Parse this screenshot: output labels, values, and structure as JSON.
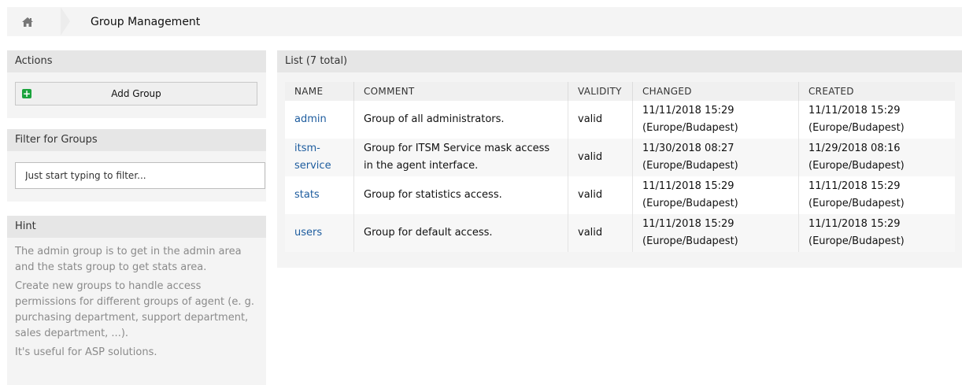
{
  "breadcrumb": {
    "home_icon": "home-icon",
    "title": "Group Management"
  },
  "actions": {
    "heading": "Actions",
    "add_label": "Add Group"
  },
  "filter": {
    "heading": "Filter for Groups",
    "placeholder": "Just start typing to filter..."
  },
  "hint": {
    "heading": "Hint",
    "paragraphs": [
      "The admin group is to get in the admin area and the stats group to get stats area.",
      "Create new groups to handle access permissions for different groups of agent (e. g. purchasing department, support department, sales department, ...).",
      "It's useful for ASP solutions."
    ]
  },
  "list": {
    "heading": "List (7 total)",
    "columns": [
      "NAME",
      "COMMENT",
      "VALIDITY",
      "CHANGED",
      "CREATED"
    ],
    "rows": [
      {
        "name": "admin",
        "comment": "Group of all administrators.",
        "validity": "valid",
        "changed": "11/11/2018 15:29 (Europe/Budapest)",
        "created": "11/11/2018 15:29 (Europe/Budapest)"
      },
      {
        "name": "itsm-service",
        "comment": "Group for ITSM Service mask access in the agent interface.",
        "validity": "valid",
        "changed": "11/30/2018 08:27 (Europe/Budapest)",
        "created": "11/29/2018 08:16 (Europe/Budapest)"
      },
      {
        "name": "stats",
        "comment": "Group for statistics access.",
        "validity": "valid",
        "changed": "11/11/2018 15:29 (Europe/Budapest)",
        "created": "11/11/2018 15:29 (Europe/Budapest)"
      },
      {
        "name": "users",
        "comment": "Group for default access.",
        "validity": "valid",
        "changed": "11/11/2018 15:29 (Europe/Budapest)",
        "created": "11/11/2018 15:29 (Europe/Budapest)"
      }
    ]
  },
  "colors": {
    "link": "#1d5c9e",
    "panel": "#f4f4f4",
    "header": "#e6e6e6",
    "add_icon": "#1aa33c",
    "hint_text": "#8a8a8a"
  }
}
